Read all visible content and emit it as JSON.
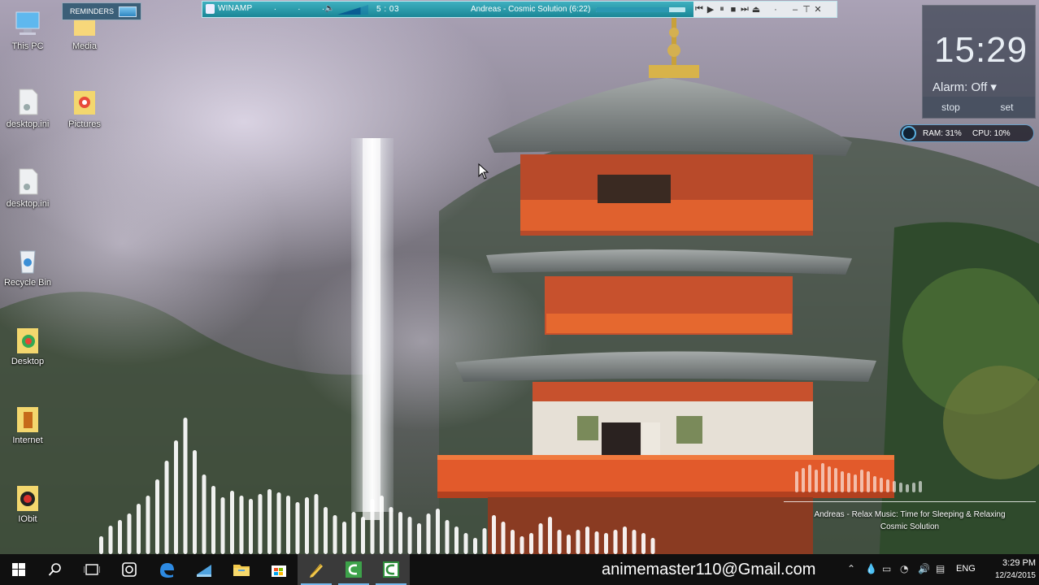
{
  "desktop": {
    "icons": [
      {
        "label": "This PC",
        "icon": "computer-icon"
      },
      {
        "label": "Media",
        "icon": "folder-icon"
      },
      {
        "label": "desktop.ini",
        "icon": "settings-file-icon"
      },
      {
        "label": "Pictures",
        "icon": "folder-icon"
      },
      {
        "label": "desktop.ini",
        "icon": "settings-file-icon"
      },
      {
        "label": "Recycle Bin",
        "icon": "recycle-bin-icon"
      },
      {
        "label": "Desktop",
        "icon": "folder-icon"
      },
      {
        "label": "Internet",
        "icon": "folder-icon"
      },
      {
        "label": "IObit",
        "icon": "folder-icon"
      }
    ]
  },
  "reminders": {
    "label": "REMINDERS"
  },
  "winamp": {
    "title": "WINAMP",
    "dots": ". . .",
    "time": "5 : 03",
    "song": "Andreas - Cosmic Solution (6:22)",
    "progress": 0.82,
    "volume": 0.75,
    "controls": [
      "previous-icon",
      "play-icon",
      "pause-icon",
      "stop-icon",
      "next-icon",
      "eject-icon",
      "menu-dot-icon",
      "minimize-icon",
      "maximize-icon",
      "close-icon"
    ],
    "control_glyphs": [
      "⏮",
      "▶",
      "⏸",
      "■",
      "⏭",
      "⏏",
      "·",
      "–",
      "⊤",
      "✕"
    ]
  },
  "clock": {
    "time": "15:29",
    "alarm": "Alarm: Off ▾",
    "stop": "stop",
    "set": "set"
  },
  "sysmon": {
    "ram": "RAM: 31%",
    "cpu": "CPU: 10%"
  },
  "nowplaying": {
    "line1": "Andreas - Relax Music: Time for Sleeping & Relaxing",
    "line2": "Cosmic Solution"
  },
  "taskbar": {
    "watermark": "animemaster110@Gmail.com",
    "language": "ENG",
    "time": "3:29 PM",
    "date": "12/24/2015",
    "apps": [
      "start-icon",
      "search-icon",
      "task-view-icon",
      "app-circle-icon",
      "edge-icon",
      "app-blue-icon",
      "file-explorer-icon",
      "store-icon",
      "app-pen-icon",
      "camtasia-icon",
      "camtasia-icon-2"
    ]
  },
  "colors": {
    "accent": "#76b9ed",
    "winamp": "#1a8797",
    "taskbar": "#101010"
  }
}
